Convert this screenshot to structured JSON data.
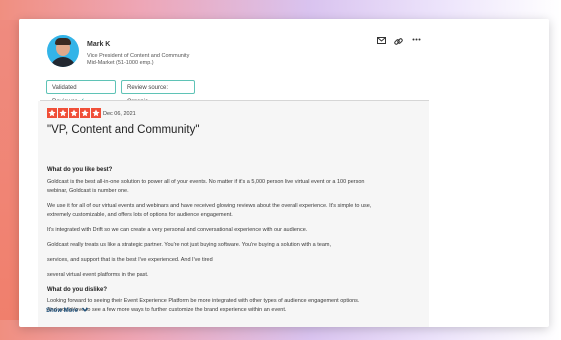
{
  "reviewer": {
    "name": "Mark K",
    "title": "Vice President of Content and Community",
    "segment": "Mid-Market (51-1000 emp.)"
  },
  "header_icons": [
    "mail-icon",
    "link-icon",
    "more-icon"
  ],
  "badges": {
    "validated": "Validated Reviewer",
    "source": "Review source: Organic"
  },
  "review": {
    "rating": 5,
    "date": "Dec 06, 2021",
    "title": "\"VP, Content and Community\"",
    "like_q": "What do you like best?",
    "like_p": [
      "Goldcast is the best all-in-one solution to power all of your events. No matter if it's a 5,000 person live virtual event or a 100 person",
      "webinar, Goldcast is number one.",
      "We use it for all of our virtual events and webinars and have received glowing reviews about the overall experience. It's simple to use,",
      "extremely customizable, and offers lots of options for audience engagement.",
      "It's integrated with Drift so we can create a very personal and conversational experience with our audience.",
      "Goldcast really treats us like a strategic partner. You're not just buying software. You're buying a solution with a team,",
      "services, and support that is the best I've experienced. And I've tired",
      "several virtual event platforms in the past."
    ],
    "dislike_q": "What do you dislike?",
    "dislike_p": [
      "Looking forward to seeing their Event Experience Platform be more integrated with other types of audience engagement options.",
      "And would love to see a few more ways to further customize the brand experience within an event."
    ],
    "show_more": "Show More"
  },
  "colors": {
    "star": "#f04e37",
    "badge_border": "#5fc3b6",
    "link": "#1d4f7a"
  }
}
